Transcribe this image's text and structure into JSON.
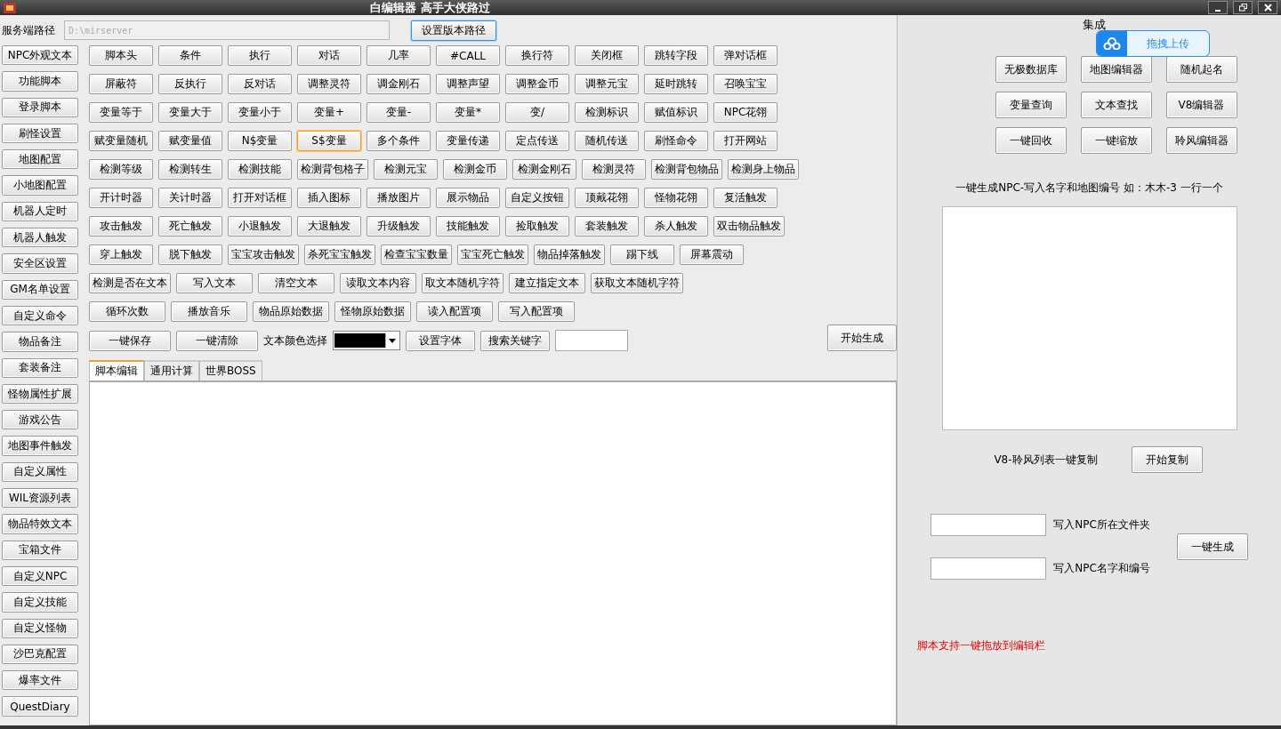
{
  "window": {
    "title": "白编辑器 高手大侠路过"
  },
  "server_path": {
    "label": "服务端路径",
    "placeholder": "D:\\mirserver",
    "button": "设置版本路径"
  },
  "sidebar": {
    "items": [
      "NPC外观文本",
      "功能脚本",
      "登录脚本",
      "刷怪设置",
      "地图配置",
      "小地图配置",
      "机器人定时",
      "机器人触发",
      "安全区设置",
      "GM名单设置",
      "自定义命令",
      "物品备注",
      "套装备注",
      "怪物属性扩展",
      "游戏公告",
      "地图事件触发",
      "自定义属性",
      "WIL资源列表",
      "物品特效文本",
      "宝箱文件",
      "自定义NPC",
      "自定义技能",
      "自定义怪物",
      "沙巴克配置",
      "爆率文件",
      "QuestDiary"
    ]
  },
  "command_rows": [
    [
      {
        "label": "脚本头",
        "focused": false
      },
      {
        "label": "条件",
        "focused": false
      },
      {
        "label": "执行",
        "focused": false
      },
      {
        "label": "对话",
        "focused": false
      },
      {
        "label": "几率",
        "focused": false
      },
      {
        "label": "#CALL",
        "focused": false
      },
      {
        "label": "换行符",
        "focused": false
      },
      {
        "label": "关闭框",
        "focused": false
      },
      {
        "label": "跳转字段",
        "focused": false
      },
      {
        "label": "弹对话框",
        "focused": false
      }
    ],
    [
      {
        "label": "屏蔽符",
        "focused": false
      },
      {
        "label": "反执行",
        "focused": false
      },
      {
        "label": "反对话",
        "focused": false
      },
      {
        "label": "调整灵符",
        "focused": false
      },
      {
        "label": "调金刚石",
        "focused": false
      },
      {
        "label": "调整声望",
        "focused": false
      },
      {
        "label": "调整金币",
        "focused": false
      },
      {
        "label": "调整元宝",
        "focused": false
      },
      {
        "label": "延时跳转",
        "focused": false
      },
      {
        "label": "召唤宝宝",
        "focused": false
      }
    ],
    [
      {
        "label": "变量等于",
        "focused": false
      },
      {
        "label": "变量大于",
        "focused": false
      },
      {
        "label": "变量小于",
        "focused": false
      },
      {
        "label": "变量+",
        "focused": false
      },
      {
        "label": "变量-",
        "focused": false
      },
      {
        "label": "变量*",
        "focused": false
      },
      {
        "label": "变/",
        "focused": false
      },
      {
        "label": "检测标识",
        "focused": false
      },
      {
        "label": "赋值标识",
        "focused": false
      },
      {
        "label": "NPC花翎",
        "focused": false
      }
    ],
    [
      {
        "label": "赋变量随机",
        "focused": false
      },
      {
        "label": "赋变量值",
        "focused": false
      },
      {
        "label": "N$变量",
        "focused": false
      },
      {
        "label": "S$变量",
        "focused": true
      },
      {
        "label": "多个条件",
        "focused": false
      },
      {
        "label": "变量传递",
        "focused": false
      },
      {
        "label": "定点传送",
        "focused": false
      },
      {
        "label": "随机传送",
        "focused": false
      },
      {
        "label": "刷怪命令",
        "focused": false
      },
      {
        "label": "打开网站",
        "focused": false
      }
    ],
    [
      {
        "label": "检测等级",
        "focused": false
      },
      {
        "label": "检测转生",
        "focused": false
      },
      {
        "label": "检测技能",
        "focused": false
      },
      {
        "label": "检测背包格子",
        "focused": false
      },
      {
        "label": "检测元宝",
        "focused": false
      },
      {
        "label": "检测金币",
        "focused": false
      },
      {
        "label": "检测金刚石",
        "focused": false
      },
      {
        "label": "检测灵符",
        "focused": false
      },
      {
        "label": "检测背包物品",
        "focused": false
      },
      {
        "label": "检测身上物品",
        "focused": false
      }
    ],
    [
      {
        "label": "开计时器",
        "focused": false
      },
      {
        "label": "关计时器",
        "focused": false
      },
      {
        "label": "打开对话框",
        "focused": false
      },
      {
        "label": "插入图标",
        "focused": false
      },
      {
        "label": "播放图片",
        "focused": false
      },
      {
        "label": "展示物品",
        "focused": false
      },
      {
        "label": "自定义按钮",
        "focused": false
      },
      {
        "label": "顶戴花翎",
        "focused": false
      },
      {
        "label": "怪物花翎",
        "focused": false
      },
      {
        "label": "复活触发",
        "focused": false
      }
    ],
    [
      {
        "label": "攻击触发",
        "focused": false
      },
      {
        "label": "死亡触发",
        "focused": false
      },
      {
        "label": "小退触发",
        "focused": false
      },
      {
        "label": "大退触发",
        "focused": false
      },
      {
        "label": "升级触发",
        "focused": false
      },
      {
        "label": "技能触发",
        "focused": false
      },
      {
        "label": "捡取触发",
        "focused": false
      },
      {
        "label": "套装触发",
        "focused": false
      },
      {
        "label": "杀人触发",
        "focused": false
      },
      {
        "label": "双击物品触发",
        "focused": false
      }
    ],
    [
      {
        "label": "穿上触发",
        "focused": false
      },
      {
        "label": "脱下触发",
        "focused": false
      },
      {
        "label": "宝宝攻击触发",
        "focused": false
      },
      {
        "label": "杀死宝宝触发",
        "focused": false
      },
      {
        "label": "检查宝宝数量",
        "focused": false
      },
      {
        "label": "宝宝死亡触发",
        "focused": false
      },
      {
        "label": "物品掉落触发",
        "focused": false
      },
      {
        "label": "踢下线",
        "focused": false
      },
      {
        "label": "屏幕震动",
        "focused": false
      }
    ],
    [
      {
        "label": "检测是否在文本",
        "focused": false
      },
      {
        "label": "写入文本",
        "focused": false
      },
      {
        "label": "清空文本",
        "focused": false
      },
      {
        "label": "读取文本内容",
        "focused": false
      },
      {
        "label": "取文本随机字符",
        "focused": false
      },
      {
        "label": "建立指定文本",
        "focused": false
      },
      {
        "label": "获取文本随机字符",
        "focused": false
      }
    ],
    [
      {
        "label": "循环次数",
        "focused": false
      },
      {
        "label": "播放音乐",
        "focused": false
      },
      {
        "label": "物品原始数据",
        "focused": false
      },
      {
        "label": "怪物原始数据",
        "focused": false
      },
      {
        "label": "读入配置项",
        "focused": false
      },
      {
        "label": "写入配置项",
        "focused": false
      }
    ]
  ],
  "tool_row": {
    "save": "一键保存",
    "clear": "一键清除",
    "color_label": "文本颜色选择",
    "color": "#000000",
    "font_button": "设置字体",
    "search_button": "搜索关键字"
  },
  "generate_button": "开始生成",
  "tabs": [
    {
      "label": "脚本编辑",
      "selected": true
    },
    {
      "label": "通用计算",
      "selected": false
    },
    {
      "label": "世界BOSS",
      "selected": false
    }
  ],
  "tools_panel": {
    "title": "集成",
    "buttons": [
      "无极数据库",
      "地图编辑器",
      "随机起名",
      "变量查询",
      "文本查找",
      "V8编辑器",
      "一键回收",
      "一键缩放",
      "聆风编辑器"
    ]
  },
  "npc_generator": {
    "hint": "一键生成NPC-写入名字和地图编号 如：木木-3 一行一个"
  },
  "copy_row": {
    "label": "V8-聆风列表一键复制",
    "button": "开始复制"
  },
  "npc_fields": [
    {
      "label": "写入NPC所在文件夹"
    },
    {
      "label": "写入NPC名字和编号"
    }
  ],
  "npc_generate_button": "一键生成",
  "note": "脚本支持一键拖放到编辑栏",
  "upload_popup": {
    "label": "拖拽上传"
  }
}
